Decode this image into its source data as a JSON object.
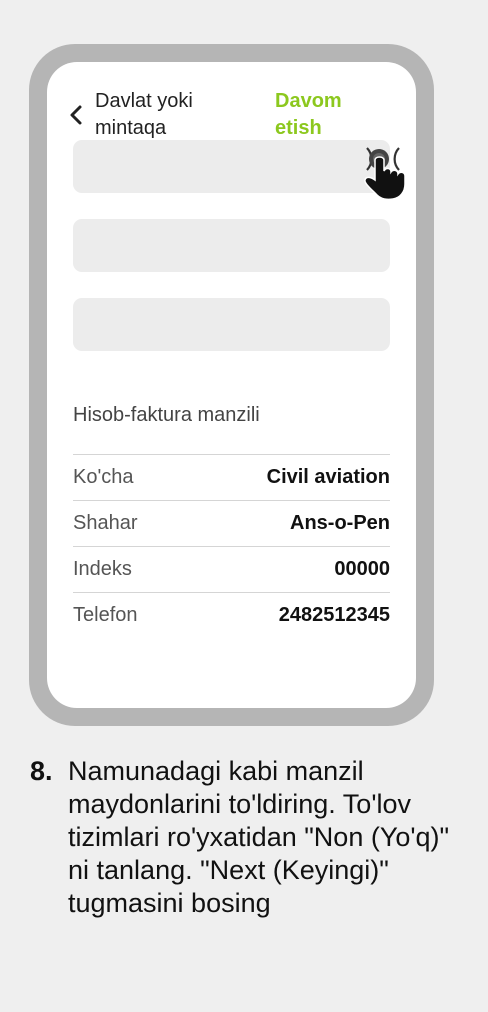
{
  "header": {
    "back_label": "Davlat yoki mintaqa",
    "continue_label": "Davom etish"
  },
  "billing": {
    "title": "Hisob-faktura manzili",
    "rows": [
      {
        "label": "Ko'cha",
        "value": "Civil aviation"
      },
      {
        "label": "Shahar",
        "value": "Ans-o-Pen"
      },
      {
        "label": "Indeks",
        "value": "00000"
      },
      {
        "label": "Telefon",
        "value": "2482512345"
      }
    ]
  },
  "instruction": {
    "number": "8.",
    "text": "Namunadagi kabi manzil maydonlarini to'ldiring. To'lov tizimlari ro'yxatidan \"Non (Yo'q)\" ni tanlang. \"Next (Keyingi)\" tugmasini bosing"
  },
  "icons": {
    "back": "chevron-left-icon",
    "tap": "tap-gesture-icon"
  },
  "colors": {
    "accent": "#8cc81e",
    "phone_frame": "#b5b5b5",
    "field": "#ececec"
  }
}
